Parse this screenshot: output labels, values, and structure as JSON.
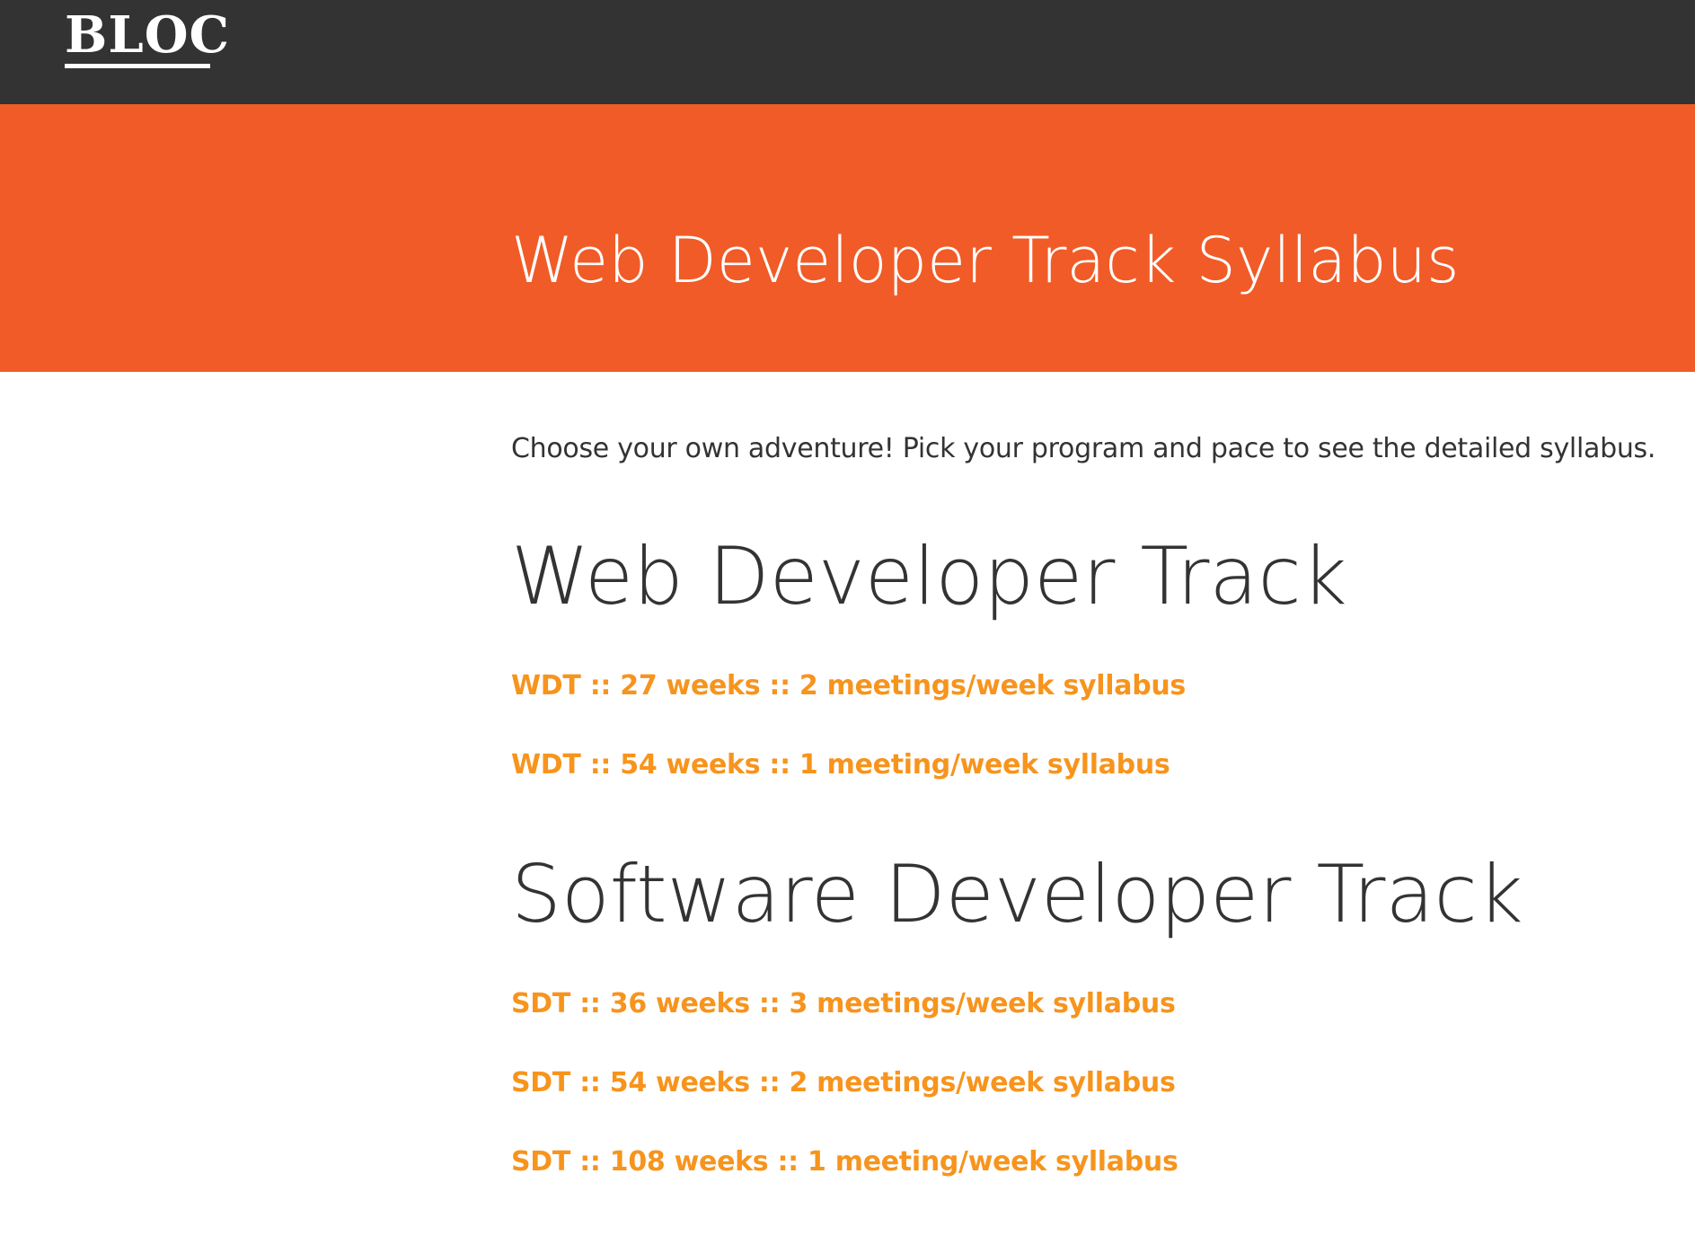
{
  "header": {
    "logo_text": "BLOC"
  },
  "hero": {
    "title": "Web Developer Track Syllabus"
  },
  "main": {
    "intro": "Choose your own adventure! Pick your program and pace to see the detailed syllabus.",
    "tracks": [
      {
        "heading": "Web Developer Track",
        "links": [
          "WDT :: 27 weeks :: 2 meetings/week syllabus",
          "WDT :: 54 weeks :: 1 meeting/week syllabus"
        ]
      },
      {
        "heading": "Software Developer Track",
        "links": [
          "SDT :: 36 weeks :: 3 meetings/week syllabus",
          "SDT :: 54 weeks :: 2 meetings/week syllabus",
          "SDT :: 108 weeks :: 1 meeting/week syllabus"
        ]
      }
    ]
  },
  "colors": {
    "topbar": "#333333",
    "hero": "#f15b27",
    "link": "#f7941d",
    "text": "#333333"
  }
}
